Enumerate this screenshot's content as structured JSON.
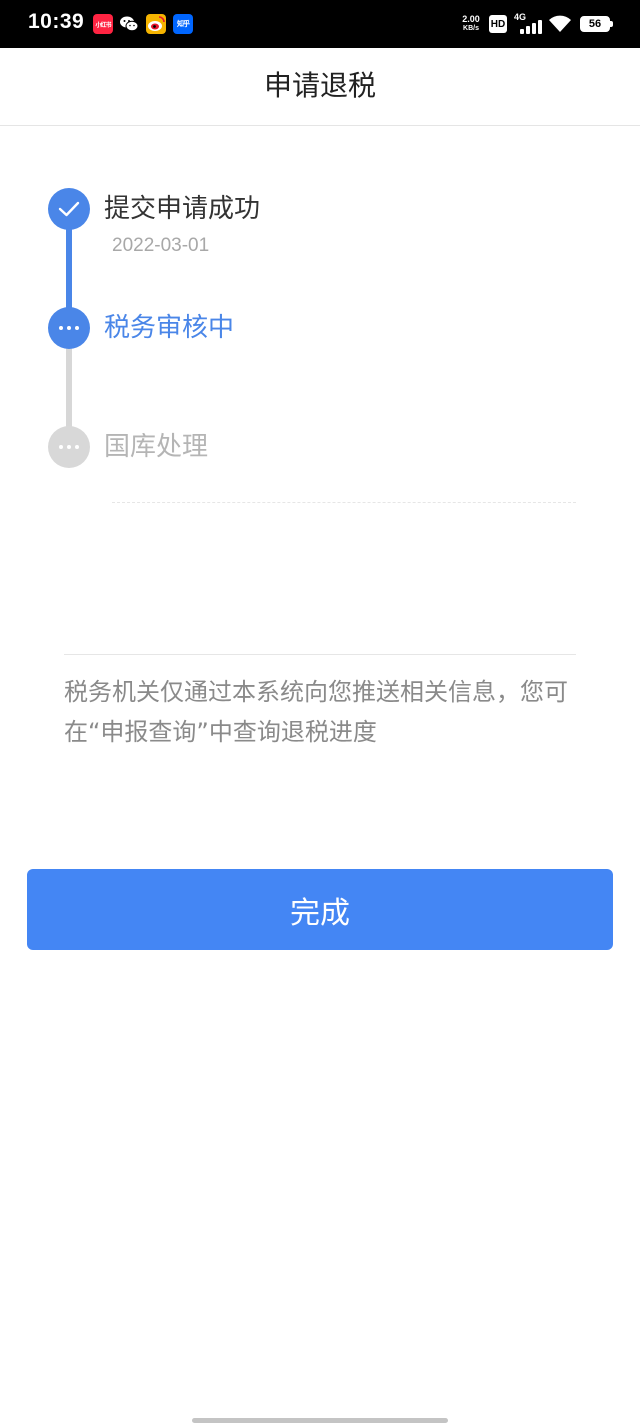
{
  "status_bar": {
    "time": "10:39",
    "apps": [
      {
        "name": "xiaohongshu-icon",
        "label": "小红书",
        "color": "#ff2442"
      },
      {
        "name": "wechat-icon",
        "label": "",
        "color": "#000000"
      },
      {
        "name": "weibo-icon",
        "label": "",
        "color": "#ffffff"
      },
      {
        "name": "zhihu-icon",
        "label": "知乎",
        "color": "#0066ff"
      }
    ],
    "net_speed_value": "2.00",
    "net_speed_unit": "KB/s",
    "hd": "HD",
    "network": "4G",
    "battery": "56"
  },
  "nav": {
    "title": "申请退税"
  },
  "steps": [
    {
      "label": "提交申请成功",
      "date": "2022-03-01",
      "state": "done",
      "color": "#333333"
    },
    {
      "label": "税务审核中",
      "state": "current",
      "color": "#4a86e8"
    },
    {
      "label": "国库处理",
      "state": "pending",
      "color": "#b5b5b5"
    }
  ],
  "notice": "税务机关仅通过本系统向您推送相关信息，您可在“申报查询”中查询退税进度",
  "button": {
    "done_label": "完成",
    "color": "#4486f4"
  }
}
